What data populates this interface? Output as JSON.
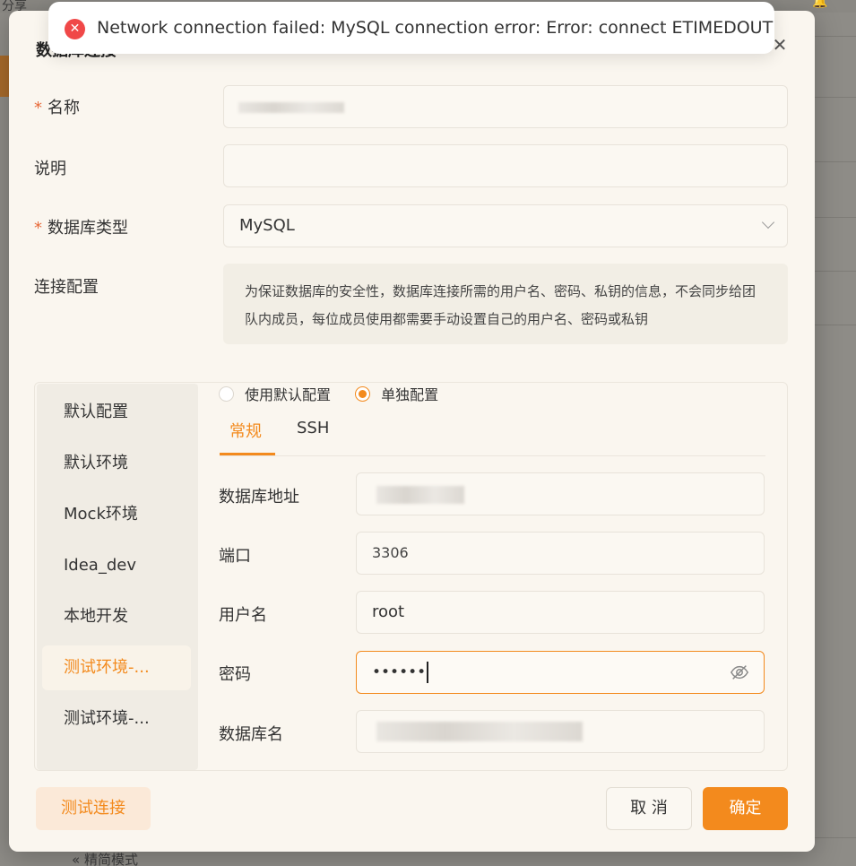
{
  "background": {
    "share_label": "分享",
    "footer_label": "« 精简模式"
  },
  "toast": {
    "message": "Network connection failed: MySQL connection error: Error: connect ETIMEDOUT",
    "icon": "error-circle-icon",
    "color": "#f04848"
  },
  "dialog": {
    "title": "数据库连接",
    "fields": {
      "name_label": "名称",
      "desc_label": "说明",
      "db_type_label": "数据库类型",
      "db_type_value": "MySQL",
      "conn_config_label": "连接配置",
      "notice": "为保证数据库的安全性，数据库连接所需的用户名、密码、私钥的信息，不会同步给团队内成员，每位成员使用都需要手动设置自己的用户名、密码或私钥"
    },
    "environments": [
      {
        "label": "默认配置"
      },
      {
        "label": "默认环境"
      },
      {
        "label": "Mock环境"
      },
      {
        "label": "Idea_dev"
      },
      {
        "label": "本地开发"
      },
      {
        "label": "测试环境-..."
      },
      {
        "label": "测试环境-..."
      }
    ],
    "active_environment_index": 5,
    "config_mode": {
      "option_default": "使用默认配置",
      "option_custom": "单独配置",
      "selected": "单独配置"
    },
    "tabs": [
      {
        "label": "常规"
      },
      {
        "label": "SSH"
      }
    ],
    "active_tab": "常规",
    "conn": {
      "host_label": "数据库地址",
      "port_label": "端口",
      "port_value": "3306",
      "user_label": "用户名",
      "user_value": "root",
      "password_label": "密码",
      "password_value": "••••••",
      "dbname_label": "数据库名"
    },
    "buttons": {
      "test": "测试连接",
      "cancel": "取 消",
      "ok": "确定"
    }
  },
  "colors": {
    "accent": "#f38a1d",
    "error": "#f04848",
    "required": "#e86a3a"
  }
}
